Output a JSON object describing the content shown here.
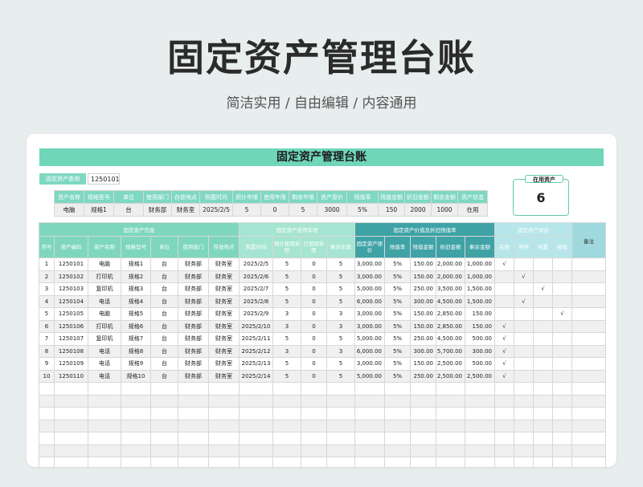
{
  "page": {
    "title": "固定资产管理台账",
    "subtitle": "简洁实用 / 自由编辑 / 内容通用"
  },
  "sheet": {
    "banner": "固定资产管理台账"
  },
  "query": {
    "label": "固定资产查询",
    "value": "1250101"
  },
  "lookup": {
    "headers": [
      "资产名称",
      "规格型号",
      "单位",
      "使用部门",
      "存放地点",
      "购置时间",
      "预计年限",
      "使用年限",
      "剩余年限",
      "资产原价",
      "残值率",
      "残值金额",
      "折旧金额",
      "剩余金额",
      "资产状态"
    ],
    "values": [
      "电脑",
      "规格1",
      "台",
      "财务部",
      "财务室",
      "2025/2/5",
      "5",
      "0",
      "5",
      "3000",
      "5%",
      "150",
      "2000",
      "1000",
      "在用"
    ]
  },
  "badge": {
    "label": "在用资产",
    "value": "6"
  },
  "groups": [
    "固定资产信息",
    "固定资产使用年限",
    "固定资产价值及折旧残值率",
    "固定资产状态",
    "备注"
  ],
  "columns": [
    "序号",
    "资产编码",
    "资产名称",
    "规格型号",
    "单位",
    "使用部门",
    "存放地点",
    "购置时间",
    "预计使用年限",
    "已使用年限",
    "剩余年限",
    "固定资产原价",
    "残值率",
    "残值金额",
    "折旧金额",
    "剩余金额",
    "在用",
    "停用",
    "闲置",
    "报废"
  ],
  "rows": [
    [
      "1",
      "1250101",
      "电脑",
      "规格1",
      "台",
      "财务部",
      "财务室",
      "2025/2/5",
      "5",
      "0",
      "5",
      "3,000.00",
      "5%",
      "150.00",
      "2,000.00",
      "1,000.00",
      "√",
      "",
      "",
      ""
    ],
    [
      "2",
      "1250102",
      "打印机",
      "规格2",
      "台",
      "财务部",
      "财务室",
      "2025/2/6",
      "5",
      "0",
      "5",
      "3,000.00",
      "5%",
      "150.00",
      "2,000.00",
      "1,000.00",
      "",
      "√",
      "",
      ""
    ],
    [
      "3",
      "1250103",
      "复印机",
      "规格3",
      "台",
      "财务部",
      "财务室",
      "2025/2/7",
      "5",
      "0",
      "5",
      "5,000.00",
      "5%",
      "250.00",
      "3,500.00",
      "1,500.00",
      "",
      "",
      "√",
      ""
    ],
    [
      "4",
      "1250104",
      "电话",
      "规格4",
      "台",
      "财务部",
      "财务室",
      "2025/2/8",
      "5",
      "0",
      "5",
      "6,000.00",
      "5%",
      "300.00",
      "4,500.00",
      "1,500.00",
      "",
      "√",
      "",
      ""
    ],
    [
      "5",
      "1250105",
      "电脑",
      "规格5",
      "台",
      "财务部",
      "财务室",
      "2025/2/9",
      "3",
      "0",
      "3",
      "3,000.00",
      "5%",
      "150.00",
      "2,850.00",
      "150.00",
      "",
      "",
      "",
      "√"
    ],
    [
      "6",
      "1250106",
      "打印机",
      "规格6",
      "台",
      "财务部",
      "财务室",
      "2025/2/10",
      "3",
      "0",
      "3",
      "3,000.00",
      "5%",
      "150.00",
      "2,850.00",
      "150.00",
      "√",
      "",
      "",
      ""
    ],
    [
      "7",
      "1250107",
      "复印机",
      "规格7",
      "台",
      "财务部",
      "财务室",
      "2025/2/11",
      "5",
      "0",
      "5",
      "5,000.00",
      "5%",
      "250.00",
      "4,500.00",
      "500.00",
      "√",
      "",
      "",
      ""
    ],
    [
      "8",
      "1250108",
      "电话",
      "规格8",
      "台",
      "财务部",
      "财务室",
      "2025/2/12",
      "3",
      "0",
      "3",
      "6,000.00",
      "5%",
      "300.00",
      "5,700.00",
      "300.00",
      "√",
      "",
      "",
      ""
    ],
    [
      "9",
      "1250109",
      "电话",
      "规格9",
      "台",
      "财务部",
      "财务室",
      "2025/2/13",
      "5",
      "0",
      "5",
      "3,000.00",
      "5%",
      "150.00",
      "2,500.00",
      "500.00",
      "√",
      "",
      "",
      ""
    ],
    [
      "10",
      "1250110",
      "电话",
      "规格10",
      "台",
      "财务部",
      "财务室",
      "2025/2/14",
      "5",
      "0",
      "5",
      "5,000.00",
      "5%",
      "250.00",
      "2,500.00",
      "2,500.00",
      "√",
      "",
      "",
      ""
    ]
  ]
}
